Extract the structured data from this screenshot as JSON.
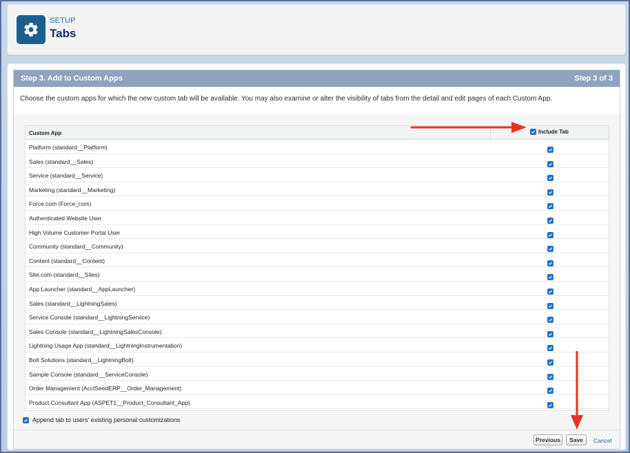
{
  "header": {
    "section_label": "SETUP",
    "title": "Tabs",
    "icon": "gear-icon"
  },
  "step": {
    "title": "Step 3. Add to Custom Apps",
    "counter": "Step 3 of 3",
    "instructions": "Choose the custom apps for which the new custom tab will be available. You may also examine or alter the visibility of tabs from the detail and edit pages of each Custom App."
  },
  "table": {
    "col_app": "Custom App",
    "col_include": "Include Tab",
    "include_all_checked": true,
    "rows": [
      {
        "label": "Platform (standard__Platform)",
        "checked": true
      },
      {
        "label": "Sales (standard__Sales)",
        "checked": true
      },
      {
        "label": "Service (standard__Service)",
        "checked": true
      },
      {
        "label": "Marketing (standard__Marketing)",
        "checked": true
      },
      {
        "label": "Force.com (Force_com)",
        "checked": true
      },
      {
        "label": "Authenticated Website User",
        "checked": true
      },
      {
        "label": "High Volume Customer Portal User",
        "checked": true
      },
      {
        "label": "Community (standard__Community)",
        "checked": true
      },
      {
        "label": "Content (standard__Content)",
        "checked": true
      },
      {
        "label": "Site.com (standard__Sites)",
        "checked": true
      },
      {
        "label": "App Launcher (standard__AppLauncher)",
        "checked": true
      },
      {
        "label": "Sales (standard__LightningSales)",
        "checked": true
      },
      {
        "label": "Service Console (standard__LightningService)",
        "checked": true
      },
      {
        "label": "Sales Console (standard__LightningSalesConsole)",
        "checked": true
      },
      {
        "label": "Lightning Usage App (standard__LightningInstrumentation)",
        "checked": true
      },
      {
        "label": "Bolt Solutions (standard__LightningBolt)",
        "checked": true
      },
      {
        "label": "Sample Console (standard__ServiceConsole)",
        "checked": true
      },
      {
        "label": "Order Management (AcctSeedERP__Order_Management)",
        "checked": true
      },
      {
        "label": "Product Consultant App (ASPET1__Product_Consultant_App)",
        "checked": true
      }
    ]
  },
  "append": {
    "label": "Append tab to users' existing personal customizations",
    "checked": true
  },
  "footer": {
    "previous_label": "Previous",
    "save_label": "Save",
    "cancel_label": "Cancel"
  },
  "colors": {
    "accent": "#1e73c8",
    "step_header": "#8ea3bf",
    "annotation_arrow": "#e8321e"
  }
}
